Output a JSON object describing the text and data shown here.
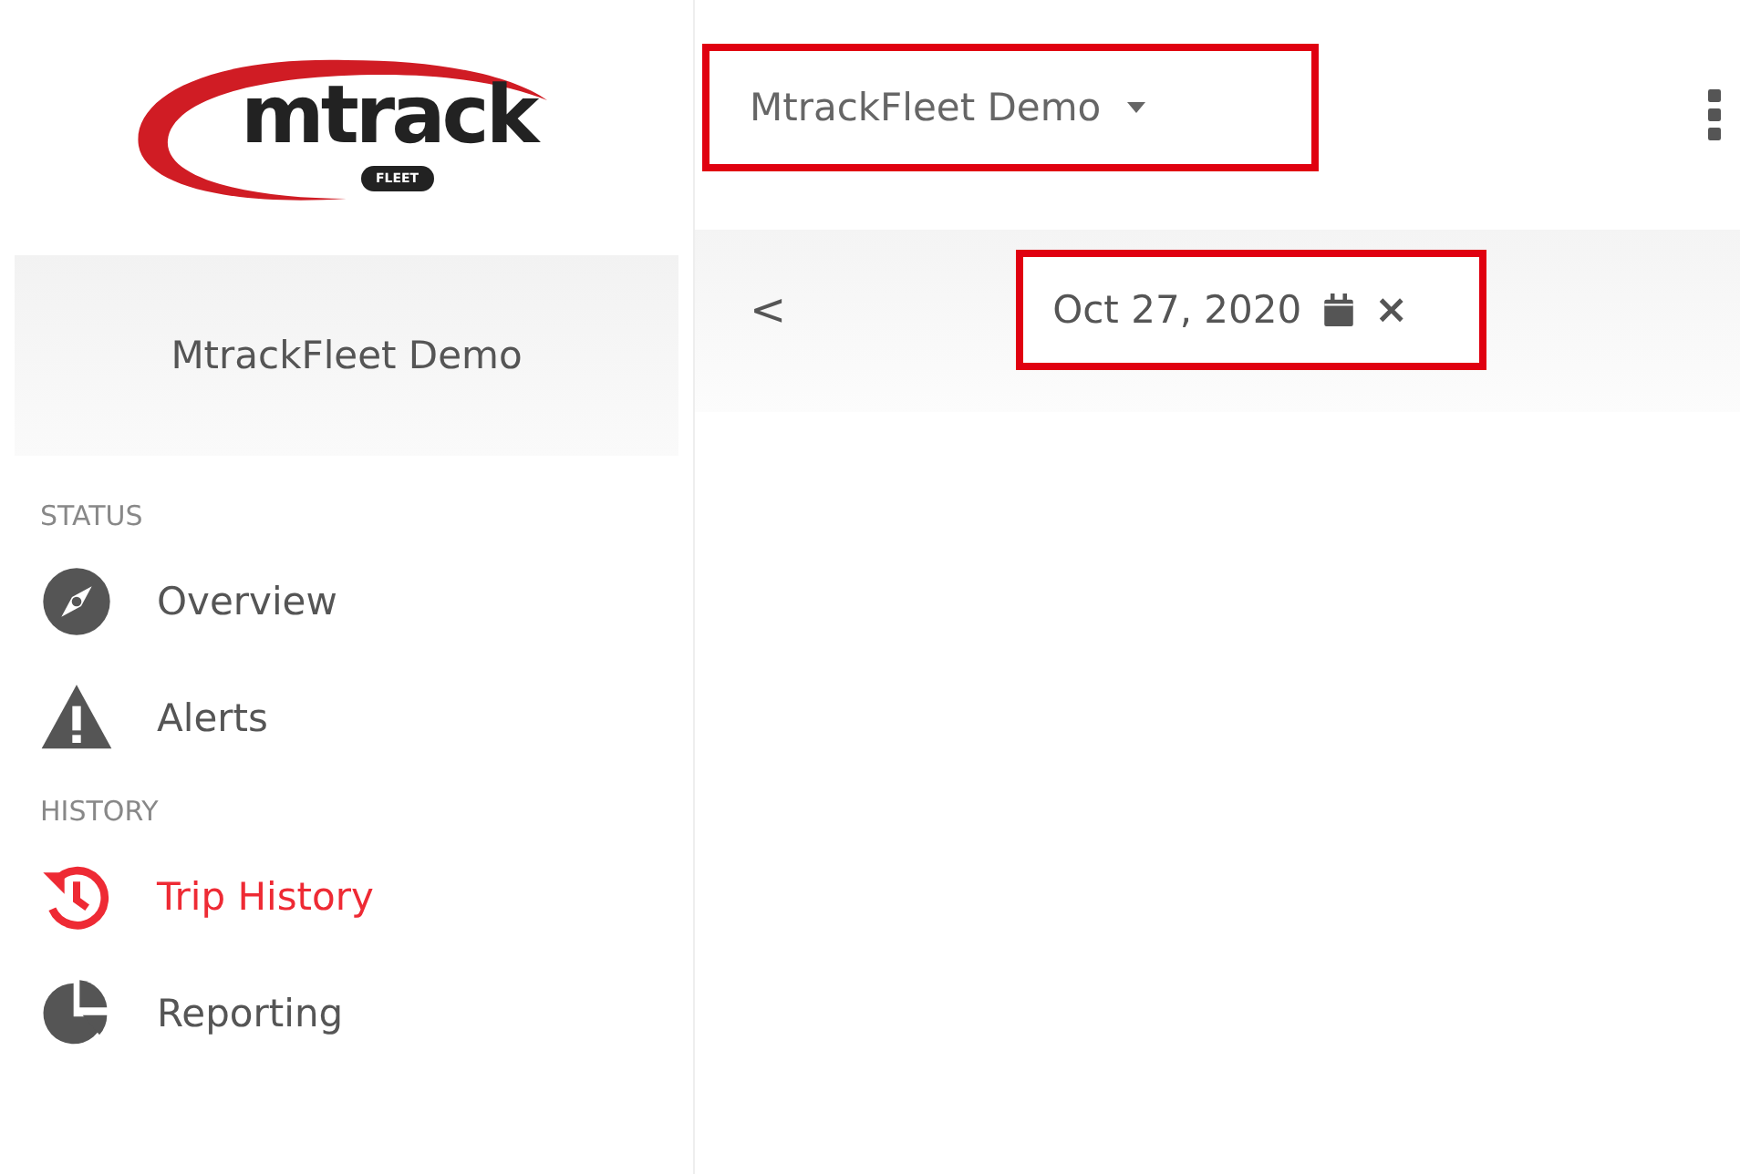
{
  "logo": {
    "text": "mtrack",
    "badge": "FLEET"
  },
  "account_name": "MtrackFleet Demo",
  "sidebar": {
    "sections": [
      {
        "title": "STATUS",
        "items": [
          {
            "label": "Overview",
            "selected": false
          },
          {
            "label": "Alerts",
            "selected": false
          }
        ]
      },
      {
        "title": "HISTORY",
        "items": [
          {
            "label": "Trip History",
            "selected": true
          },
          {
            "label": "Reporting",
            "selected": false
          }
        ]
      }
    ]
  },
  "account_selector": {
    "value": "MtrackFleet Demo",
    "highlighted": true
  },
  "date_picker": {
    "back": "<",
    "value": "Oct 27, 2020",
    "clear": "×",
    "highlighted": true
  }
}
